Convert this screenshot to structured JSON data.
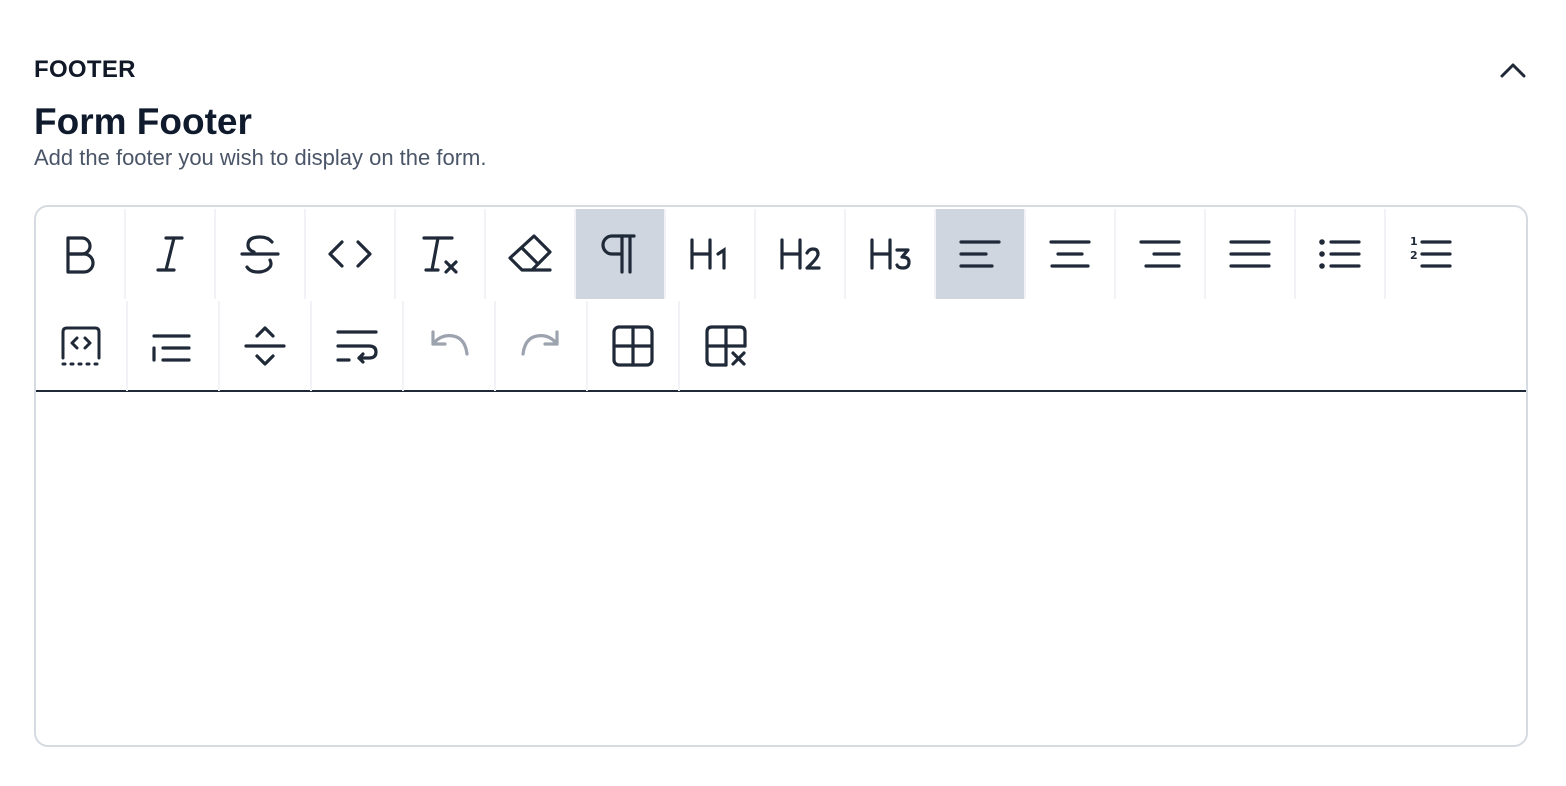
{
  "section": {
    "title": "FOOTER",
    "collapse_icon": "chevron-up-icon"
  },
  "field": {
    "title": "Form Footer",
    "description": "Add the footer you wish to display on the form."
  },
  "editor": {
    "content": "",
    "toolbar_row1": [
      {
        "icon": "bold-icon",
        "active": false
      },
      {
        "icon": "italic-icon",
        "active": false
      },
      {
        "icon": "strikethrough-icon",
        "active": false
      },
      {
        "icon": "code-icon",
        "active": false
      },
      {
        "icon": "clear-format-icon",
        "active": false
      },
      {
        "icon": "eraser-icon",
        "active": false
      },
      {
        "icon": "paragraph-icon",
        "active": true
      },
      {
        "icon": "heading-1-icon",
        "active": false
      },
      {
        "icon": "heading-2-icon",
        "active": false
      },
      {
        "icon": "heading-3-icon",
        "active": false
      },
      {
        "icon": "align-left-icon",
        "active": true
      },
      {
        "icon": "align-center-icon",
        "active": false
      },
      {
        "icon": "align-right-icon",
        "active": false
      },
      {
        "icon": "align-justify-icon",
        "active": false
      },
      {
        "icon": "bullet-list-icon",
        "active": false
      },
      {
        "icon": "ordered-list-icon",
        "active": false
      }
    ],
    "toolbar_row2": [
      {
        "icon": "code-block-icon",
        "active": false
      },
      {
        "icon": "indent-icon",
        "active": false
      },
      {
        "icon": "horizontal-rule-icon",
        "active": false
      },
      {
        "icon": "hard-break-icon",
        "active": false
      },
      {
        "icon": "undo-icon",
        "active": false,
        "disabled": true
      },
      {
        "icon": "redo-icon",
        "active": false,
        "disabled": true
      },
      {
        "icon": "insert-table-icon",
        "active": false
      },
      {
        "icon": "delete-table-icon",
        "active": false
      }
    ],
    "colors": {
      "icon": "#1f2937",
      "icon_disabled": "#9ca3af",
      "active_bg": "#cfd6df"
    }
  }
}
